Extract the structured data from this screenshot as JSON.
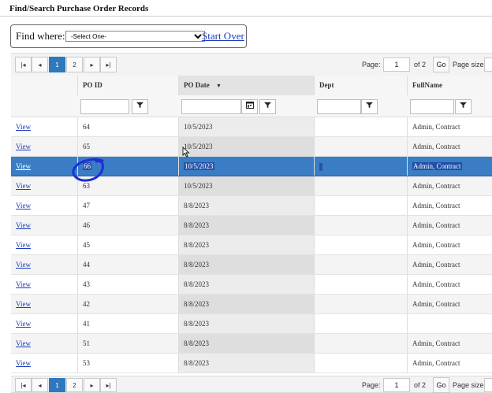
{
  "page": {
    "title": "Find/Search Purchase Order Records"
  },
  "find": {
    "label": "Find where:",
    "select_value": "-Select One-",
    "start_over": "Start Over"
  },
  "pager_top": {
    "first": "|◂",
    "prev": "◂",
    "page1": "1",
    "page2": "2",
    "next": "▸",
    "last": "▸|",
    "page_label": "Page:",
    "page_value": "1",
    "of_label": "of 2",
    "go_label": "Go",
    "size_label": "Page size:"
  },
  "pager_bottom": {
    "first": "|◂",
    "prev": "◂",
    "page1": "1",
    "page2": "2",
    "next": "▸",
    "last": "▸|",
    "page_label": "Page:",
    "page_value": "1",
    "of_label": "of 2",
    "go_label": "Go",
    "size_label": "Page size:"
  },
  "columns": {
    "po_id": "PO ID",
    "po_date": "PO Date",
    "sort_indicator": "▼",
    "dept": "Dept",
    "full_name": "FullName"
  },
  "rows": [
    {
      "view": "View",
      "po_id": "64",
      "po_date": "10/5/2023",
      "dept": "",
      "full_name": "Admin, Contract"
    },
    {
      "view": "View",
      "po_id": "65",
      "po_date": "10/5/2023",
      "dept": "",
      "full_name": "Admin, Contract"
    },
    {
      "view": "View",
      "po_id": "66",
      "po_date": "10/5/2023",
      "dept": "",
      "full_name": "Admin, Contract"
    },
    {
      "view": "View",
      "po_id": "63",
      "po_date": "10/5/2023",
      "dept": "",
      "full_name": "Admin, Contract"
    },
    {
      "view": "View",
      "po_id": "47",
      "po_date": "8/8/2023",
      "dept": "",
      "full_name": "Admin, Contract"
    },
    {
      "view": "View",
      "po_id": "46",
      "po_date": "8/8/2023",
      "dept": "",
      "full_name": "Admin, Contract"
    },
    {
      "view": "View",
      "po_id": "45",
      "po_date": "8/8/2023",
      "dept": "",
      "full_name": "Admin, Contract"
    },
    {
      "view": "View",
      "po_id": "44",
      "po_date": "8/8/2023",
      "dept": "",
      "full_name": "Admin, Contract"
    },
    {
      "view": "View",
      "po_id": "43",
      "po_date": "8/8/2023",
      "dept": "",
      "full_name": "Admin, Contract"
    },
    {
      "view": "View",
      "po_id": "42",
      "po_date": "8/8/2023",
      "dept": "",
      "full_name": "Admin, Contract"
    },
    {
      "view": "View",
      "po_id": "41",
      "po_date": "8/8/2023",
      "dept": "",
      "full_name": ""
    },
    {
      "view": "View",
      "po_id": "51",
      "po_date": "8/8/2023",
      "dept": "",
      "full_name": "Admin, Contract"
    },
    {
      "view": "View",
      "po_id": "53",
      "po_date": "8/8/2023",
      "dept": "",
      "full_name": "Admin, Contract"
    }
  ],
  "selected_row_index": 2,
  "colors": {
    "selection": "#3a7dc4",
    "active_page": "#2e78bd",
    "link": "#1a3cbf",
    "annotation": "#1d2fd6"
  },
  "icons": {
    "filter": "funnel-icon",
    "calendar": "calendar-icon"
  }
}
